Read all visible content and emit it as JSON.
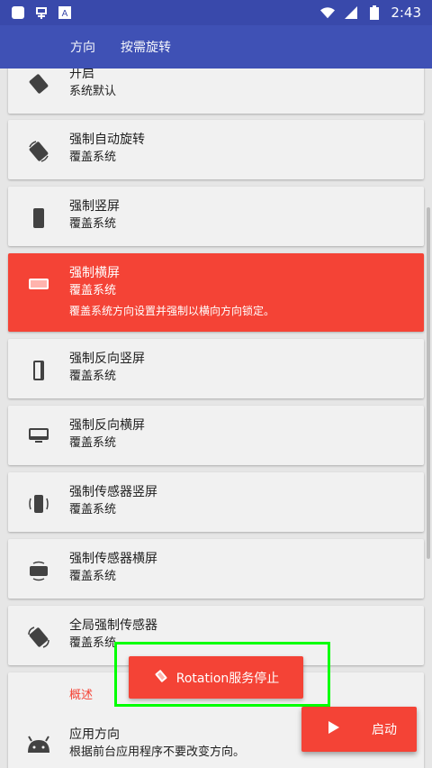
{
  "status_bar": {
    "time": "2:43",
    "icons": [
      "square-icon",
      "app-icon",
      "a-icon",
      "wifi-icon",
      "signal-icon",
      "battery-icon"
    ]
  },
  "tabs": [
    {
      "label": "方向"
    },
    {
      "label": "按需旋转"
    }
  ],
  "items": [
    {
      "title": "开启",
      "subtitle": "系统默认",
      "icon": "rotate-diamond-icon"
    },
    {
      "title": "强制自动旋转",
      "subtitle": "覆盖系统",
      "icon": "auto-rotate-icon"
    },
    {
      "title": "强制竖屏",
      "subtitle": "覆盖系统",
      "icon": "portrait-icon"
    },
    {
      "title": "强制横屏",
      "subtitle": "覆盖系统",
      "description": "覆盖系统方向设置并强制以横向方向锁定。",
      "icon": "landscape-icon",
      "active": true
    },
    {
      "title": "强制反向竖屏",
      "subtitle": "覆盖系统",
      "icon": "reverse-portrait-icon"
    },
    {
      "title": "强制反向横屏",
      "subtitle": "覆盖系统",
      "icon": "reverse-landscape-icon"
    },
    {
      "title": "强制传感器竖屏",
      "subtitle": "覆盖系统",
      "icon": "sensor-portrait-icon"
    },
    {
      "title": "强制传感器横屏",
      "subtitle": "覆盖系统",
      "icon": "sensor-landscape-icon"
    },
    {
      "title": "全局强制传感器",
      "subtitle": "覆盖系统",
      "icon": "global-sensor-icon"
    }
  ],
  "overview": {
    "section_label": "概述",
    "app_orientation": {
      "title": "应用方向",
      "subtitle": "根据前台应用程序不要改变方向。",
      "icon": "android-icon"
    }
  },
  "toast": {
    "text": "Rotation服务停止",
    "icon": "rotation-icon"
  },
  "fab": {
    "label": "启动",
    "icon": "play-icon"
  },
  "colors": {
    "primary": "#3f51b5",
    "status_bar": "#3949ab",
    "accent": "#f44336",
    "card": "#f1f1f1",
    "background": "#e6e6e6"
  }
}
